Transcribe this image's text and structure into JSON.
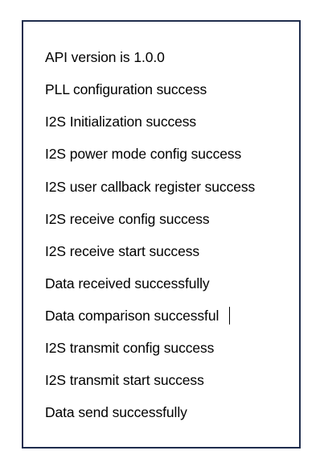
{
  "log": {
    "lines": [
      "API version is 1.0.0",
      "PLL configuration success",
      "I2S Initialization success",
      "I2S power mode config success",
      "I2S user callback register success",
      "I2S receive config success",
      "I2S receive start success",
      "Data received successfully",
      "Data comparison successful",
      "I2S transmit config success",
      "I2S transmit start success",
      "Data send successfully"
    ]
  },
  "colors": {
    "border": "#1f2d4d",
    "text": "#000000",
    "background": "#ffffff"
  }
}
